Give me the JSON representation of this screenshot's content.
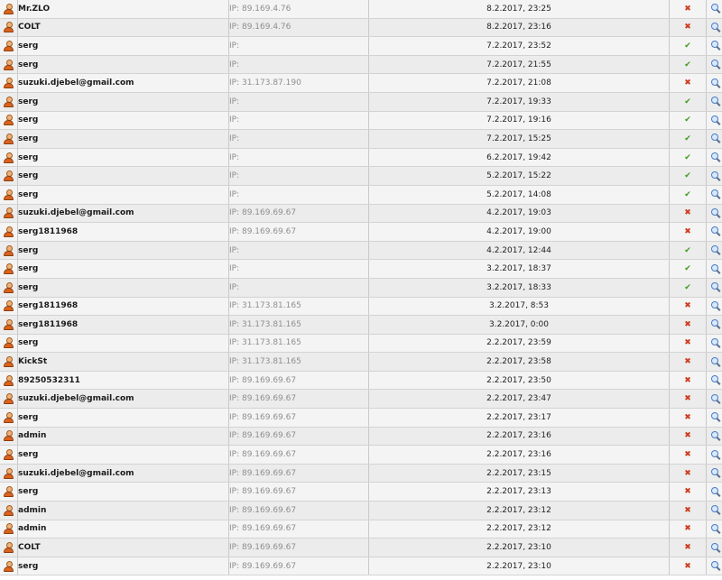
{
  "colors": {
    "success": "#3f9a1e",
    "failure": "#d03a1e",
    "ip_text": "#8e8e8e"
  },
  "icons": {
    "user": "user-icon",
    "success": "checkmark-icon",
    "failure": "cross-icon",
    "view": "magnifier-icon"
  },
  "ip_prefix": "IP:",
  "rows": [
    {
      "user": "Mr.ZLO",
      "ip": "IP: 89.169.4.76",
      "date": "8.2.2017, 23:25",
      "status": "fail"
    },
    {
      "user": "COLT",
      "ip": "IP: 89.169.4.76",
      "date": "8.2.2017, 23:16",
      "status": "fail"
    },
    {
      "user": "serg",
      "ip": "IP:",
      "date": "7.2.2017, 23:52",
      "status": "ok"
    },
    {
      "user": "serg",
      "ip": "IP:",
      "date": "7.2.2017, 21:55",
      "status": "ok"
    },
    {
      "user": "suzuki.djebel@gmail.com",
      "ip": "IP: 31.173.87.190",
      "date": "7.2.2017, 21:08",
      "status": "fail"
    },
    {
      "user": "serg",
      "ip": "IP:",
      "date": "7.2.2017, 19:33",
      "status": "ok"
    },
    {
      "user": "serg",
      "ip": "IP:",
      "date": "7.2.2017, 19:16",
      "status": "ok"
    },
    {
      "user": "serg",
      "ip": "IP:",
      "date": "7.2.2017, 15:25",
      "status": "ok"
    },
    {
      "user": "serg",
      "ip": "IP:",
      "date": "6.2.2017, 19:42",
      "status": "ok"
    },
    {
      "user": "serg",
      "ip": "IP:",
      "date": "5.2.2017, 15:22",
      "status": "ok"
    },
    {
      "user": "serg",
      "ip": "IP:",
      "date": "5.2.2017, 14:08",
      "status": "ok"
    },
    {
      "user": "suzuki.djebel@gmail.com",
      "ip": "IP: 89.169.69.67",
      "date": "4.2.2017, 19:03",
      "status": "fail"
    },
    {
      "user": "serg1811968",
      "ip": "IP: 89.169.69.67",
      "date": "4.2.2017, 19:00",
      "status": "fail"
    },
    {
      "user": "serg",
      "ip": "IP:",
      "date": "4.2.2017, 12:44",
      "status": "ok"
    },
    {
      "user": "serg",
      "ip": "IP:",
      "date": "3.2.2017, 18:37",
      "status": "ok"
    },
    {
      "user": "serg",
      "ip": "IP:",
      "date": "3.2.2017, 18:33",
      "status": "ok"
    },
    {
      "user": "serg1811968",
      "ip": "IP: 31.173.81.165",
      "date": "3.2.2017, 8:53",
      "status": "fail"
    },
    {
      "user": "serg1811968",
      "ip": "IP: 31.173.81.165",
      "date": "3.2.2017, 0:00",
      "status": "fail"
    },
    {
      "user": "serg",
      "ip": "IP: 31.173.81.165",
      "date": "2.2.2017, 23:59",
      "status": "fail"
    },
    {
      "user": "KickSt",
      "ip": "IP: 31.173.81.165",
      "date": "2.2.2017, 23:58",
      "status": "fail"
    },
    {
      "user": "89250532311",
      "ip": "IP: 89.169.69.67",
      "date": "2.2.2017, 23:50",
      "status": "fail"
    },
    {
      "user": "suzuki.djebel@gmail.com",
      "ip": "IP: 89.169.69.67",
      "date": "2.2.2017, 23:47",
      "status": "fail"
    },
    {
      "user": "serg",
      "ip": "IP: 89.169.69.67",
      "date": "2.2.2017, 23:17",
      "status": "fail"
    },
    {
      "user": "admin",
      "ip": "IP: 89.169.69.67",
      "date": "2.2.2017, 23:16",
      "status": "fail"
    },
    {
      "user": "serg",
      "ip": "IP: 89.169.69.67",
      "date": "2.2.2017, 23:16",
      "status": "fail"
    },
    {
      "user": "suzuki.djebel@gmail.com",
      "ip": "IP: 89.169.69.67",
      "date": "2.2.2017, 23:15",
      "status": "fail"
    },
    {
      "user": "serg",
      "ip": "IP: 89.169.69.67",
      "date": "2.2.2017, 23:13",
      "status": "fail"
    },
    {
      "user": "admin",
      "ip": "IP: 89.169.69.67",
      "date": "2.2.2017, 23:12",
      "status": "fail"
    },
    {
      "user": "admin",
      "ip": "IP: 89.169.69.67",
      "date": "2.2.2017, 23:12",
      "status": "fail"
    },
    {
      "user": "COLT",
      "ip": "IP: 89.169.69.67",
      "date": "2.2.2017, 23:10",
      "status": "fail"
    },
    {
      "user": "serg",
      "ip": "IP: 89.169.69.67",
      "date": "2.2.2017, 23:10",
      "status": "fail"
    }
  ]
}
